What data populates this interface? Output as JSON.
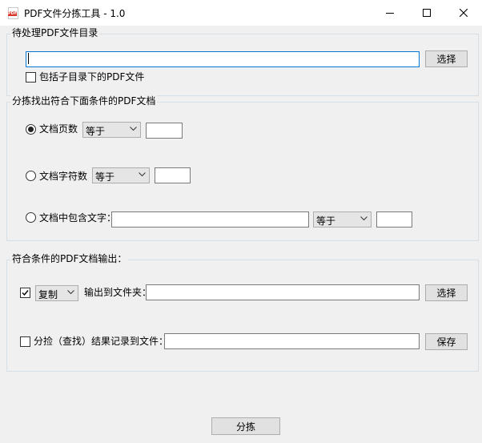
{
  "window": {
    "title": "PDF文件分拣工具 - 1.0",
    "icon_label": "PDF"
  },
  "input_section": {
    "title": "待处理PDF文件目录",
    "directory_value": "",
    "browse_button": "选择",
    "include_subdirs_label": "包括子目录下的PDF文件",
    "include_subdirs_checked": false
  },
  "filter_section": {
    "title": "分拣找出符合下面条件的PDF文档",
    "page_count": {
      "label": "文档页数",
      "selected": true,
      "operator": "等于",
      "value": ""
    },
    "char_count": {
      "label": "文档字符数",
      "selected": false,
      "operator": "等于",
      "value": ""
    },
    "contains_text": {
      "label": "文档中包含文字：",
      "selected": false,
      "text_value": "",
      "operator": "等于",
      "value": ""
    }
  },
  "output_section": {
    "title": "符合条件的PDF文档输出：",
    "copy_checked": true,
    "copy_mode": "复制",
    "output_folder_label": "输出到文件夹：",
    "output_folder_value": "",
    "browse_button": "选择",
    "log_checked": false,
    "log_label": "分捡（查找）结果记录到文件：",
    "log_file_value": "",
    "save_button": "保存"
  },
  "footer": {
    "run_button": "分拣"
  },
  "colors": {
    "window_bg": "#f0f0f0",
    "titlebar_bg": "#ffffff",
    "focus_border": "#0078d7",
    "pdf_icon_red": "#d9352b"
  }
}
